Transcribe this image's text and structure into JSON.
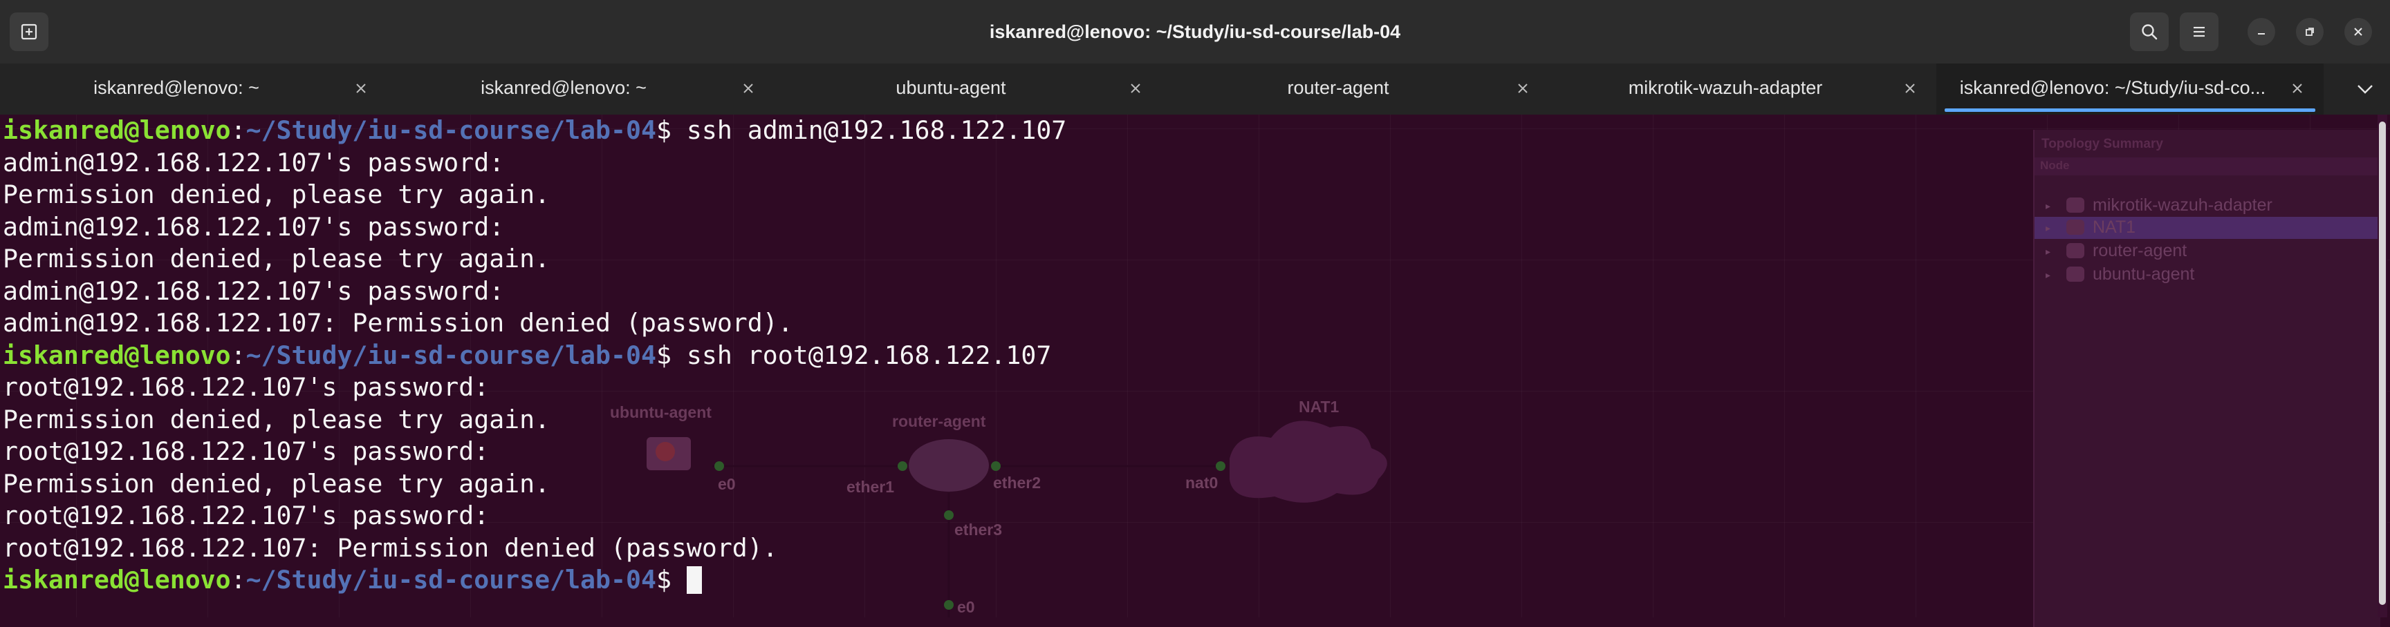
{
  "window": {
    "title": "iskanred@lenovo: ~/Study/iu-sd-course/lab-04"
  },
  "tabs": [
    {
      "label": "iskanred@lenovo: ~"
    },
    {
      "label": "iskanred@lenovo: ~"
    },
    {
      "label": "ubuntu-agent"
    },
    {
      "label": "router-agent"
    },
    {
      "label": "mikrotik-wazuh-adapter"
    },
    {
      "label": "iskanred@lenovo: ~/Study/iu-sd-co..."
    }
  ],
  "active_tab_index": 5,
  "icons": {
    "new_tab": "new-tab-icon",
    "search": "search-icon",
    "menu": "hamburger-menu-icon",
    "minimize": "minimize-icon",
    "restore": "restore-icon",
    "close": "close-icon",
    "tabs_dropdown": "chevron-down-icon"
  },
  "terminal": {
    "prompt_user": "iskanred@lenovo",
    "prompt_path": "~/Study/iu-sd-course/lab-04",
    "lines": [
      {
        "type": "prompt",
        "cmd": " ssh admin@192.168.122.107"
      },
      {
        "type": "out",
        "text": "admin@192.168.122.107's password:"
      },
      {
        "type": "out",
        "text": "Permission denied, please try again."
      },
      {
        "type": "out",
        "text": "admin@192.168.122.107's password:"
      },
      {
        "type": "out",
        "text": "Permission denied, please try again."
      },
      {
        "type": "out",
        "text": "admin@192.168.122.107's password:"
      },
      {
        "type": "out",
        "text": "admin@192.168.122.107: Permission denied (password)."
      },
      {
        "type": "prompt",
        "cmd": " ssh root@192.168.122.107"
      },
      {
        "type": "out",
        "text": "root@192.168.122.107's password:"
      },
      {
        "type": "out",
        "text": "Permission denied, please try again."
      },
      {
        "type": "out",
        "text": "root@192.168.122.107's password:"
      },
      {
        "type": "out",
        "text": "Permission denied, please try again."
      },
      {
        "type": "out",
        "text": "root@192.168.122.107's password:"
      },
      {
        "type": "out",
        "text": "root@192.168.122.107: Permission denied (password)."
      },
      {
        "type": "prompt",
        "cmd": " "
      }
    ]
  },
  "background": {
    "panel_title": "Topology Summary",
    "panel_header": "Node",
    "nodes": [
      {
        "label": "mikrotik-wazuh-adapter"
      },
      {
        "label": "NAT1"
      },
      {
        "label": "router-agent"
      },
      {
        "label": "ubuntu-agent"
      }
    ],
    "canvas_labels": {
      "ubuntu_agent": "ubuntu-agent",
      "router_agent": "router-agent",
      "nat1": "NAT1",
      "e0_left": "e0",
      "ether1": "ether1",
      "ether2": "ether2",
      "nat0": "nat0",
      "ether3": "ether3",
      "e0_bottom": "e0"
    }
  }
}
